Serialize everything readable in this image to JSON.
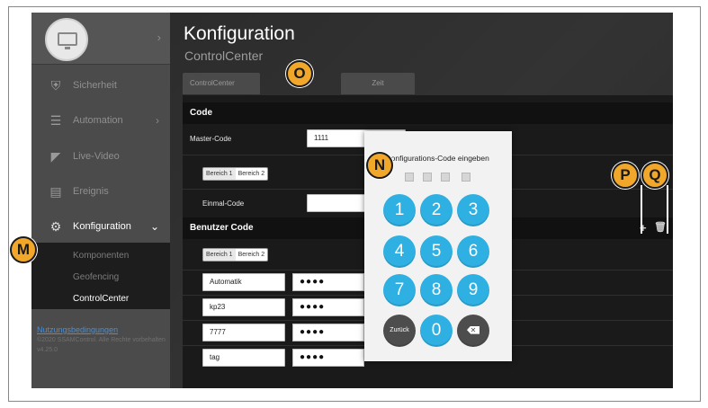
{
  "sidebar": {
    "items": [
      {
        "label": "Sicherheit",
        "icon": "shield-icon"
      },
      {
        "label": "Automation",
        "icon": "sliders-icon"
      },
      {
        "label": "Live-Video",
        "icon": "camera-icon"
      },
      {
        "label": "Ereignis",
        "icon": "list-icon"
      },
      {
        "label": "Konfiguration",
        "icon": "gear-icon"
      }
    ],
    "sub_items": [
      "Komponenten",
      "Geofencing",
      "ControlCenter"
    ],
    "footer": {
      "link": "Nutzungsbedingungen",
      "copyright": "©2020 SSAMControl. Alle Rechte vorbehalten",
      "version": "v4.25.0"
    }
  },
  "header": {
    "title": "Konfiguration",
    "subtitle": "ControlCenter"
  },
  "tabs": [
    "ControlCenter",
    "Zeit"
  ],
  "code_section": {
    "heading": "Code",
    "master_label": "Master-Code",
    "master_value": "1111",
    "bereich_1": "Bereich 1",
    "bereich_2": "Bereich 2",
    "einmal_label": "Einmal-Code"
  },
  "user_section": {
    "heading": "Benutzer Code",
    "bereich_1": "Bereich 1",
    "bereich_2": "Bereich 2",
    "users": [
      {
        "name": "Automatik",
        "code": "●●●●"
      },
      {
        "name": "kp23",
        "code": "●●●●"
      },
      {
        "name": "7777",
        "code": "●●●●"
      },
      {
        "name": "tag",
        "code": "●●●●"
      }
    ],
    "add_icon": "+",
    "delete_icon": "🗑"
  },
  "keypad": {
    "title": "Konfigurations-Code eingeben",
    "keys": [
      "1",
      "2",
      "3",
      "4",
      "5",
      "6",
      "7",
      "8",
      "9",
      "Zurück",
      "0",
      "backspace"
    ],
    "back_label": "Zurück",
    "backspace_glyph": "✕"
  },
  "callouts": [
    "M",
    "N",
    "O",
    "P",
    "Q"
  ],
  "colors": {
    "accent": "#2fb0e2",
    "callout": "#f0a72a",
    "sidebar": "#4b4b4b",
    "link": "#4a8fd6"
  }
}
